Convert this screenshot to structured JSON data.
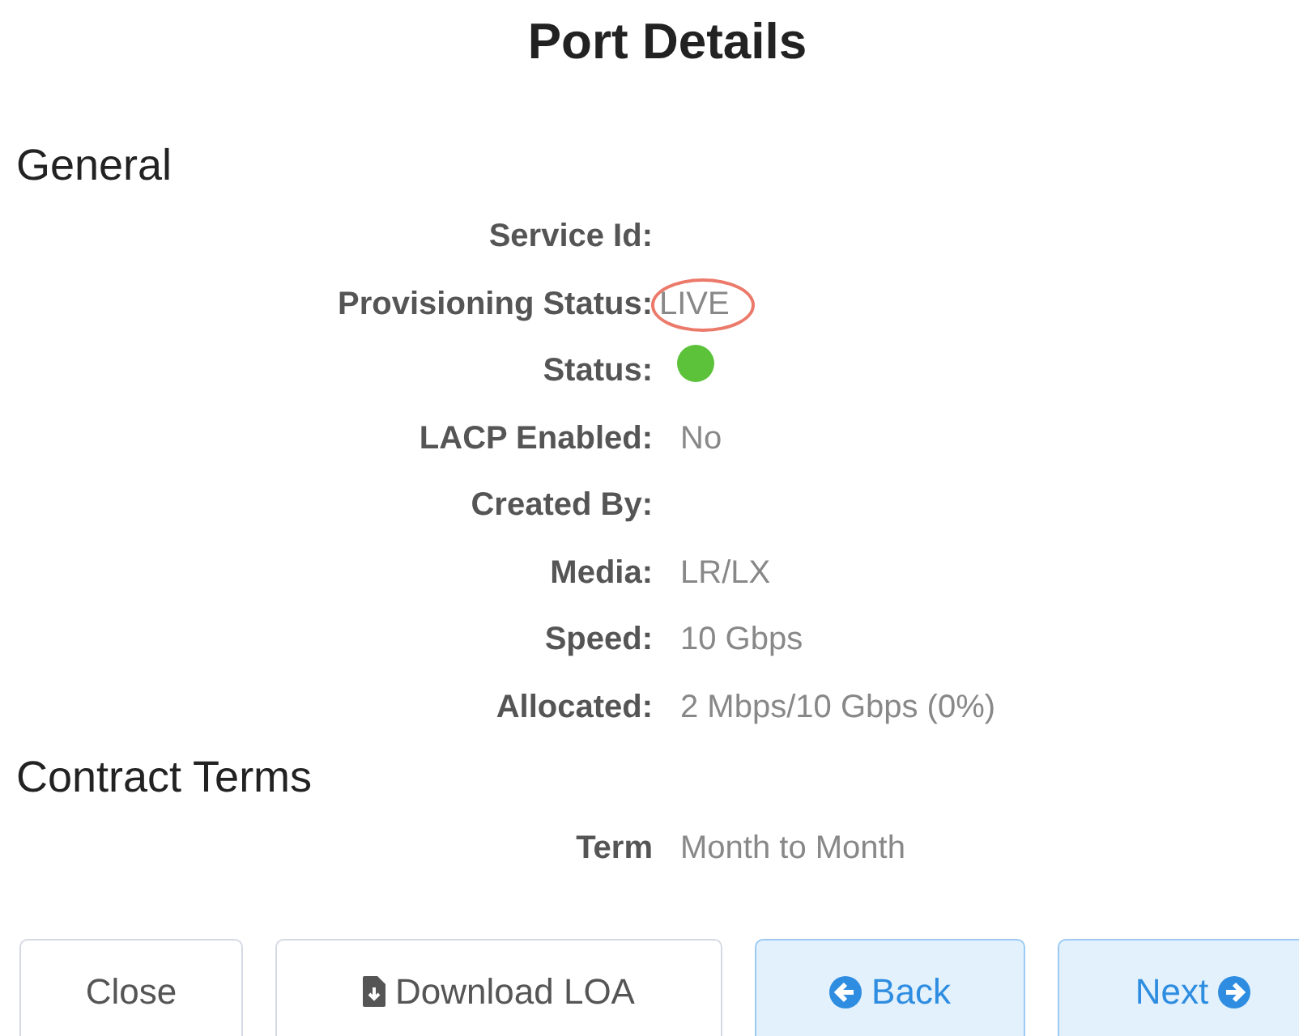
{
  "title": "Port Details",
  "sections": [
    {
      "heading": "General",
      "fields": [
        {
          "label": "Service Id:",
          "kind": "text"
        },
        {
          "label": "Provisioning Status:",
          "kind": "text",
          "value": "LIVE",
          "highlighted": true
        },
        {
          "label": "Status:",
          "kind": "dot",
          "color": "#5cc23a"
        },
        {
          "label": "LACP Enabled:",
          "kind": "text",
          "value": "No"
        },
        {
          "label": "Created By:",
          "kind": "text"
        },
        {
          "label": "Media:",
          "kind": "text",
          "value": "LR/LX"
        },
        {
          "label": "Speed:",
          "kind": "text",
          "value": "10 Gbps"
        },
        {
          "label": "Allocated:",
          "kind": "text",
          "value": "2 Mbps/10 Gbps (0%)"
        }
      ]
    },
    {
      "heading": "Contract Terms",
      "fields": [
        {
          "label": "Term",
          "kind": "text",
          "value": "Month to Month"
        }
      ]
    }
  ],
  "buttons": [
    {
      "label": "Close",
      "kind": "close"
    },
    {
      "label": "Download LOA",
      "kind": "download"
    },
    {
      "label": "Back",
      "kind": "back"
    },
    {
      "label": "Next",
      "kind": "next"
    }
  ]
}
